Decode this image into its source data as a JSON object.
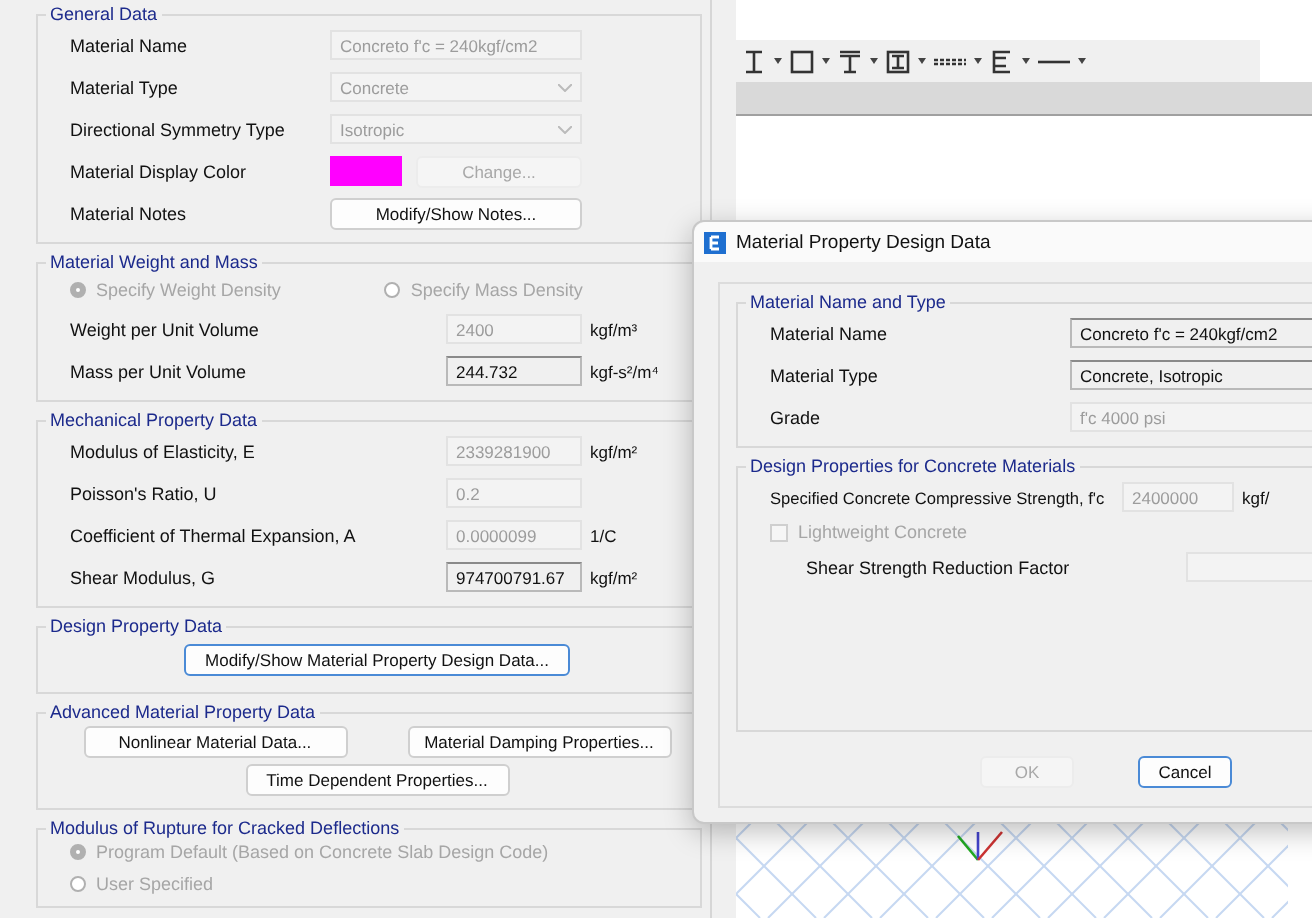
{
  "material_panel": {
    "general_data": {
      "title": "General Data",
      "rows": [
        {
          "kind": "text",
          "label": "Material Name",
          "value": "Concreto f'c = 240kgf/cm2",
          "disabled": true
        },
        {
          "kind": "dropdown",
          "label": "Material Type",
          "value": "Concrete",
          "disabled": true
        },
        {
          "kind": "dropdown",
          "label": "Directional Symmetry Type",
          "value": "Isotropic",
          "disabled": true
        },
        {
          "kind": "color",
          "label": "Material Display Color",
          "color": "#ff00ff",
          "button": "Change...",
          "disabled": true
        },
        {
          "kind": "button",
          "label": "Material Notes",
          "button": "Modify/Show Notes...",
          "disabled": false
        }
      ]
    },
    "weight_and_mass": {
      "title": "Material Weight and Mass",
      "radios": [
        {
          "label": "Specify Weight Density",
          "selected": true,
          "disabled": true
        },
        {
          "label": "Specify Mass Density",
          "selected": false,
          "disabled": true
        }
      ],
      "rows": [
        {
          "label": "Weight per Unit Volume",
          "value": "2400",
          "unit": "kgf/m³",
          "disabled": true
        },
        {
          "label": "Mass per Unit Volume",
          "value": "244.732",
          "unit": "kgf-s²/m⁴",
          "disabled": false
        }
      ]
    },
    "mechanical": {
      "title": "Mechanical Property Data",
      "rows": [
        {
          "label": "Modulus of Elasticity,  E",
          "value": "2339281900",
          "unit": "kgf/m²",
          "disabled": true
        },
        {
          "label": "Poisson's Ratio,  U",
          "value": "0.2",
          "disabled": true
        },
        {
          "label": "Coefficient of Thermal Expansion,  A",
          "value": "0.0000099",
          "unit": "1/C",
          "disabled": true
        },
        {
          "label": "Shear Modulus,  G",
          "value": "974700791.67",
          "unit": "kgf/m²",
          "disabled": false
        }
      ]
    },
    "design": {
      "title": "Design Property Data",
      "button": "Modify/Show Material Property Design Data..."
    },
    "advanced": {
      "title": "Advanced Material Property Data",
      "buttons": [
        "Nonlinear Material Data...",
        "Material Damping Properties...",
        "Time Dependent Properties..."
      ]
    },
    "rupture": {
      "title": "Modulus of Rupture for Cracked Deflections",
      "radios": [
        {
          "label": "Program Default  (Based on Concrete Slab Design Code)",
          "selected": true,
          "disabled": true
        },
        {
          "label": "User Specified",
          "selected": false,
          "disabled": true
        }
      ]
    }
  },
  "dialog": {
    "title": "Material Property Design Data",
    "name_and_type": {
      "title": "Material Name and Type",
      "rows": [
        {
          "label": "Material Name",
          "value": "Concreto f'c = 240kgf/cm2",
          "disabled": false
        },
        {
          "label": "Material Type",
          "value": "Concrete, Isotropic",
          "disabled": false
        },
        {
          "label": "Grade",
          "value": "f'c 4000 psi",
          "disabled": true
        }
      ]
    },
    "concrete_design": {
      "title": "Design Properties for Concrete Materials",
      "strength": {
        "label": "Specified Concrete Compressive Strength, f'c",
        "value": "2400000",
        "unit": "kgf/",
        "disabled": true
      },
      "lightweight": {
        "label": "Lightweight Concrete",
        "checked": false,
        "disabled": true
      },
      "reduction": {
        "label": "Shear Strength Reduction Factor",
        "disabled": true
      }
    },
    "buttons": [
      {
        "label": "OK",
        "disabled": true
      },
      {
        "label": "Cancel",
        "disabled": false
      }
    ]
  }
}
